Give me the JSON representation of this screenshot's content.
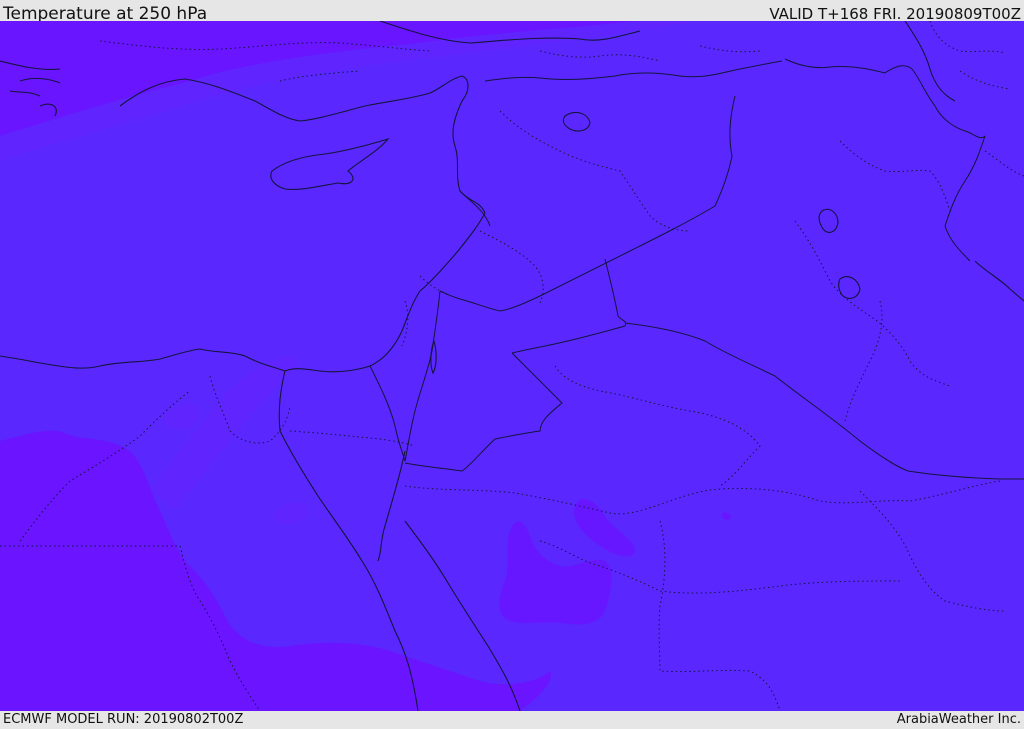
{
  "header": {
    "title": "Temperature at 250 hPa",
    "valid": "VALID T+168 FRI. 20190809T00Z"
  },
  "footer": {
    "model_run": "ECMWF MODEL RUN: 20190802T00Z",
    "credit": "ArabiaWeather Inc."
  },
  "map": {
    "field_colors": {
      "base": "#5a28ff",
      "colder": "#6a14ff",
      "transition": "#6223ff",
      "coastline": "#14143c"
    }
  }
}
